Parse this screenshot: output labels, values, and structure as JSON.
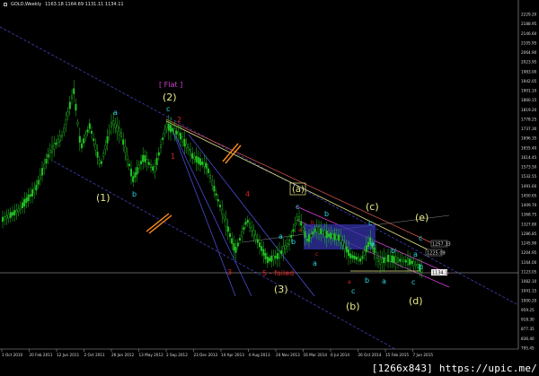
{
  "header": {
    "symbol": "GOLD,Weekly",
    "ohlc": "1163.18 1164.69 1131.11 1134.11"
  },
  "watermark": "[1266x843] https://upic.me/",
  "price_scale": [
    "2229.20",
    "2188.95",
    "2146.60",
    "2105.95",
    "2064.90",
    "2023.95",
    "1983.00",
    "1942.05",
    "1901.10",
    "1860.15",
    "1819.20",
    "1778.25",
    "1737.30",
    "1696.35",
    "1655.40",
    "1614.45",
    "1573.50",
    "1532.55",
    "1491.60",
    "1450.65",
    "1409.70",
    "1368.75",
    "1327.80",
    "1286.85",
    "1245.90",
    "1204.95",
    "1164.00",
    "1123.05",
    "1082.10",
    "1041.15",
    "1000.20",
    "959.25",
    "918.30",
    "877.35",
    "836.40",
    "795.45"
  ],
  "price_tags": {
    "current": "1134.11",
    "level1": "1257.33",
    "level2": "1225.09"
  },
  "time_scale": [
    "1 Oct 2010",
    "20 Feb 2011",
    "12 Jun 2011",
    "2 Oct 2011",
    "26 Jan 2012",
    "13 May 2012",
    "2 Sep 2012",
    "23 Dec 2012",
    "14 Apr 2013",
    "4 Aug 2013",
    "24 Nov 2013",
    "16 Mar 2014",
    "6 Jul 2014",
    "26 Oct 2014",
    "15 Feb 2015",
    "7 Jun 2015"
  ],
  "wave_labels": {
    "flat": "[ Flat ]",
    "w2": "(2)",
    "w1": "(1)",
    "w3": "(3)",
    "wa": "(a)",
    "wb": "(b)",
    "wc": "(c)",
    "wd": "(d)",
    "we": "(e)",
    "failed": "5 - failed"
  },
  "colors": {
    "background": "#000000",
    "bull": "#22c722",
    "bear": "#22c722",
    "grid": "#333333",
    "channel": "#4a4ad6",
    "yellow": "#e9e98a",
    "cyan": "#2ad6e6",
    "red": "#e12121",
    "magenta": "#d63fd6",
    "orange": "#ff8c1a"
  }
}
